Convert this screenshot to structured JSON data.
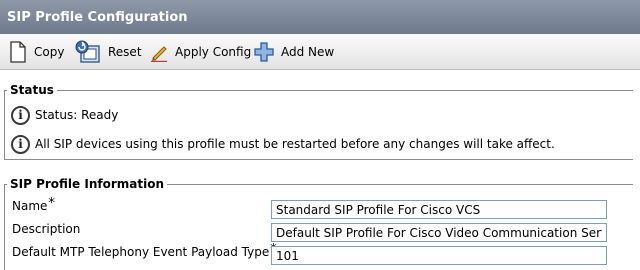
{
  "header": {
    "title": "SIP Profile Configuration"
  },
  "toolbar": {
    "copy_label": "Copy",
    "reset_label": "Reset",
    "apply_label": "Apply Config",
    "add_label": "Add New"
  },
  "status": {
    "legend": "Status",
    "messages": [
      "Status: Ready",
      "All SIP devices using this profile must be restarted before any changes will take affect."
    ]
  },
  "profile": {
    "legend": "SIP Profile Information",
    "required_marker": "*",
    "fields": [
      {
        "label": "Name",
        "value": "Standard SIP Profile For Cisco VCS",
        "required": true
      },
      {
        "label": "Description",
        "value": "Default SIP Profile For Cisco Video Communication Server",
        "required": false
      },
      {
        "label": "Default MTP Telephony Event Payload Type",
        "value": "101",
        "required": true
      }
    ]
  },
  "colors": {
    "titlebar": "#7a8596",
    "input_border": "#7f9db9"
  }
}
